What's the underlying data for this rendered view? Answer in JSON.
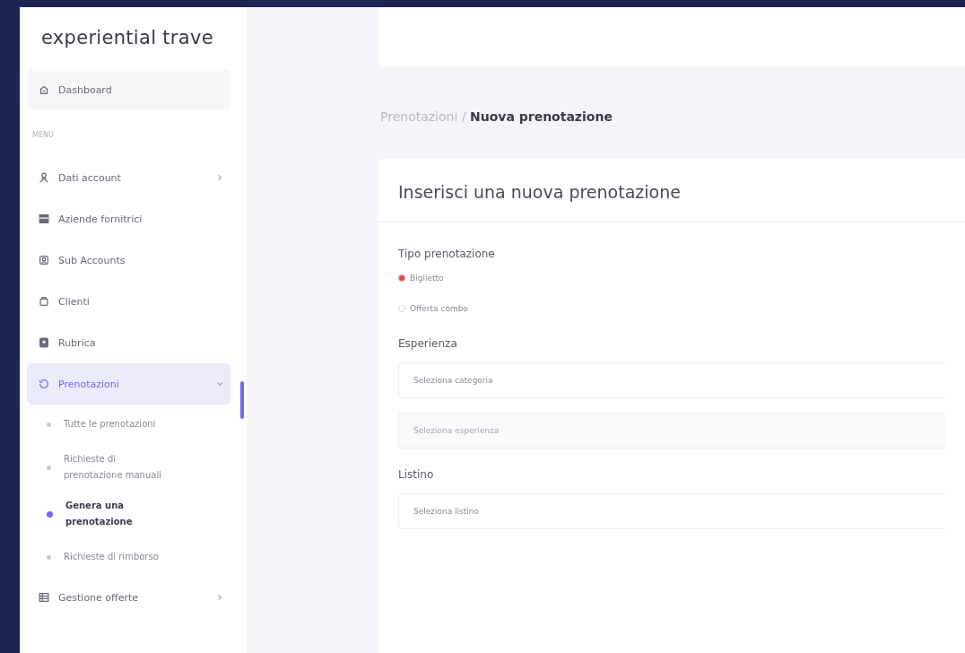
{
  "sidebar": {
    "logo": "experiential trave",
    "items": [
      {
        "kind": "top",
        "label": "Dashboard",
        "selected": false
      },
      {
        "kind": "header",
        "label": "MENU"
      },
      {
        "kind": "link",
        "label": "Dati account",
        "selected": false,
        "expanded": false
      },
      {
        "kind": "link",
        "label": "Aziende fornitrici",
        "selected": false
      },
      {
        "kind": "link",
        "label": "Sub Accounts",
        "selected": false
      },
      {
        "kind": "link",
        "label": "Clienti",
        "selected": false
      },
      {
        "kind": "link",
        "label": "Rubrica",
        "selected": false
      },
      {
        "kind": "link",
        "label": "Prenotazioni",
        "selected": true,
        "expanded": true,
        "children": [
          {
            "label": "Tutte le prenotazioni",
            "selected": false
          },
          {
            "label": "Richieste di prenotazione manuali",
            "selected": false
          },
          {
            "label": "Genera una prenotazione",
            "selected": true
          },
          {
            "label": "Richieste di rimborso",
            "selected": false
          }
        ]
      },
      {
        "kind": "link",
        "label": "Gestione offerte",
        "selected": false,
        "expanded": false
      }
    ]
  },
  "breadcrumb": {
    "parent": "Prenotazioni",
    "separator": "/",
    "current": "Nuova prenotazione"
  },
  "card": {
    "title": "Inserisci una nuova prenotazione",
    "groups": [
      {
        "kind": "radio",
        "label": "Tipo prenotazione",
        "options": [
          {
            "label": "Biglietto",
            "selected": true
          },
          {
            "label": "Offerta combo",
            "selected": false
          }
        ]
      },
      {
        "kind": "select",
        "label": "Esperienza",
        "selects": [
          {
            "placeholder": "Seleziona categoria",
            "disabled": false
          },
          {
            "placeholder": "Seleziona esperienza",
            "disabled": true
          }
        ]
      },
      {
        "kind": "select",
        "label": "Listino",
        "selects": [
          {
            "placeholder": "Seleziona listino",
            "disabled": false
          }
        ]
      }
    ]
  }
}
